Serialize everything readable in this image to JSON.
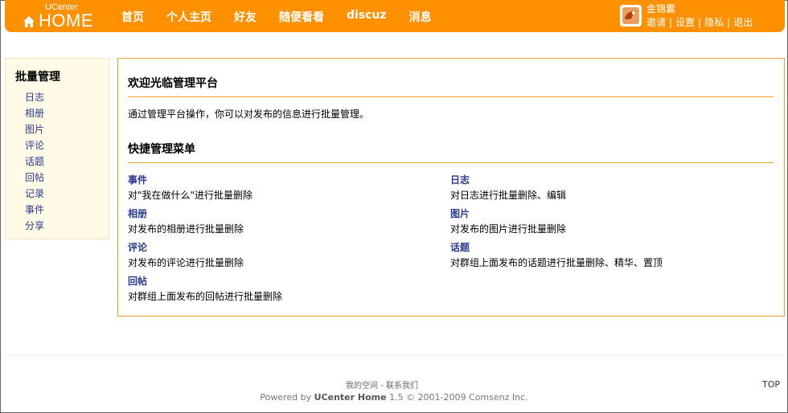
{
  "header": {
    "logo_small": "UCenter",
    "logo_big": "HOME",
    "nav": [
      "首页",
      "个人主页",
      "好友",
      "随便看看",
      "discuz",
      "消息"
    ],
    "username": "金锦囊",
    "links": [
      "邀请",
      "设置",
      "隐私",
      "退出"
    ],
    "link_sep": "|"
  },
  "sidebar": {
    "title": "批量管理",
    "items": [
      "日志",
      "相册",
      "图片",
      "评论",
      "话题",
      "回帖",
      "记录",
      "事件",
      "分享"
    ]
  },
  "main": {
    "welcome_title": "欢迎光临管理平台",
    "intro": "通过管理平台操作，你可以对发布的信息进行批量管理。",
    "menu_title": "快捷管理菜单",
    "items": [
      {
        "title": "事件",
        "desc": "对\"我在做什么\"进行批量删除"
      },
      {
        "title": "日志",
        "desc": "对日志进行批量删除、编辑"
      },
      {
        "title": "相册",
        "desc": "对发布的相册进行批量删除"
      },
      {
        "title": "图片",
        "desc": "对发布的图片进行批量删除"
      },
      {
        "title": "评论",
        "desc": "对发布的评论进行批量删除"
      },
      {
        "title": "话题",
        "desc": "对群组上面发布的话题进行批量删除、精华、置顶"
      },
      {
        "title": "回帖",
        "desc": "对群组上面发布的回帖进行批量删除"
      }
    ]
  },
  "footer": {
    "link_my_space": "我的空间",
    "link_sep": " - ",
    "link_contact": "联系我们",
    "powered_prefix": "Powered by ",
    "powered_brand": "UCenter Home",
    "powered_suffix": " 1.5 © 2001-2009 Comsenz Inc.",
    "top": "TOP"
  },
  "colors": {
    "header": "#ff9000",
    "link": "#2b3a8a",
    "rule": "#f0a030",
    "sidebar_bg": "#fffbe6"
  }
}
